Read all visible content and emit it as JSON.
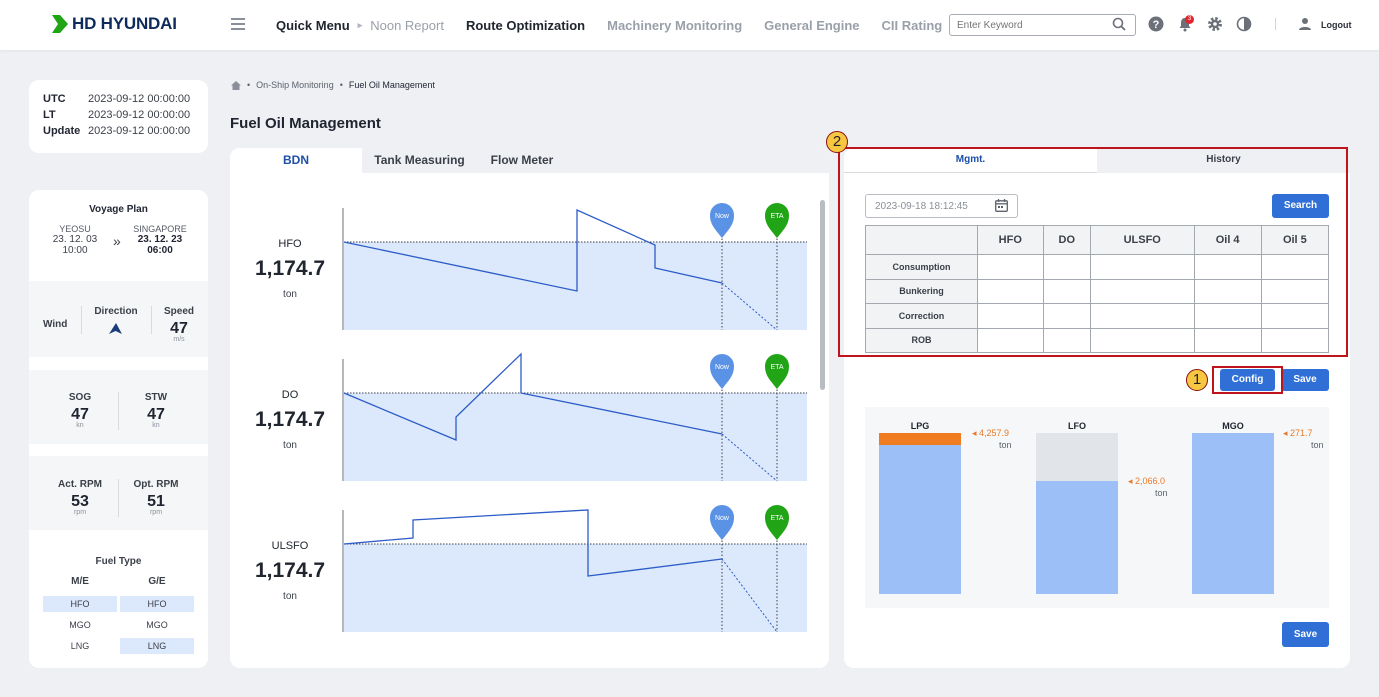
{
  "brand": {
    "name": "HD HYUNDAI"
  },
  "nav": {
    "quick_menu": "Quick Menu",
    "noon_report": "Noon Report",
    "items": [
      "Route Optimization",
      "Machinery Monitoring",
      "General Engine",
      "CII Rating"
    ],
    "more": "»"
  },
  "search": {
    "placeholder": "Enter Keyword"
  },
  "notifications": {
    "count": "3"
  },
  "user": {
    "logout": "Logout"
  },
  "time": {
    "utc_label": "UTC",
    "utc": "2023-09-12 00:00:00",
    "lt_label": "LT",
    "lt": "2023-09-12 00:00:00",
    "update_label": "Update",
    "update": "2023-09-12 00:00:00"
  },
  "voyage": {
    "title": "Voyage Plan",
    "from_port": "YEOSU",
    "from_date": "23. 12. 03",
    "from_time": "10:00",
    "to_port": "SINGAPORE",
    "to_date": "23. 12. 23",
    "to_time": "06:00",
    "arrow": "»"
  },
  "wind": {
    "label": "Wind",
    "direction_label": "Direction",
    "speed_label": "Speed",
    "speed": "47",
    "speed_unit": "m/s"
  },
  "speeds": {
    "sog_label": "SOG",
    "sog": "47",
    "sog_unit": "kn",
    "stw_label": "STW",
    "stw": "47",
    "stw_unit": "kn"
  },
  "rpm": {
    "act_label": "Act. RPM",
    "act": "53",
    "act_unit": "rpm",
    "opt_label": "Opt. RPM",
    "opt": "51",
    "opt_unit": "rpm"
  },
  "fuel_type": {
    "title": "Fuel Type",
    "me_label": "M/E",
    "ge_label": "G/E",
    "me": [
      "HFO",
      "MGO",
      "LNG"
    ],
    "ge": [
      "HFO",
      "MGO",
      "LNG"
    ],
    "me_selected": "HFO",
    "ge_selected": [
      "HFO",
      "LNG"
    ]
  },
  "breadcrumb": {
    "level1": "On-Ship Monitoring",
    "level2": "Fuel Oil Management"
  },
  "page_title": "Fuel Oil Management",
  "left_tabs": {
    "bdn": "BDN",
    "tank": "Tank Measuring",
    "flow": "Flow Meter"
  },
  "tanks": [
    {
      "name": "HFO",
      "value": "1,174.7",
      "unit": "ton"
    },
    {
      "name": "DO",
      "value": "1,174.7",
      "unit": "ton"
    },
    {
      "name": "ULSFO",
      "value": "1,174.7",
      "unit": "ton"
    }
  ],
  "markers": {
    "now": "Now",
    "eta": "ETA"
  },
  "annotations": {
    "one": "1",
    "two": "2"
  },
  "right_tabs": {
    "mgmt": "Mgmt.",
    "history": "History"
  },
  "mgmt": {
    "date": "2023-09-18 18:12:45",
    "search_btn": "Search",
    "columns": [
      "HFO",
      "DO",
      "ULSFO",
      "Oil 4",
      "Oil 5"
    ],
    "rows": [
      "Consumption",
      "Bunkering",
      "Correction",
      "ROB"
    ],
    "config_btn": "Config",
    "save_btn": "Save"
  },
  "tank_bars": [
    {
      "name": "LPG",
      "value": "4,257.9",
      "unit": "ton",
      "fill_fraction": 0.95
    },
    {
      "name": "LFO",
      "value": "2,066.0",
      "unit": "ton",
      "fill_fraction": 0.7
    },
    {
      "name": "MGO",
      "value": "271.7",
      "unit": "ton",
      "fill_fraction": 1.0
    }
  ],
  "bottom_save": "Save",
  "colors": {
    "accent": "#2f6fd6",
    "brand": "#0f2b5b",
    "green": "#21a516",
    "orange": "#f07c22",
    "highlight": "#c0141c"
  }
}
